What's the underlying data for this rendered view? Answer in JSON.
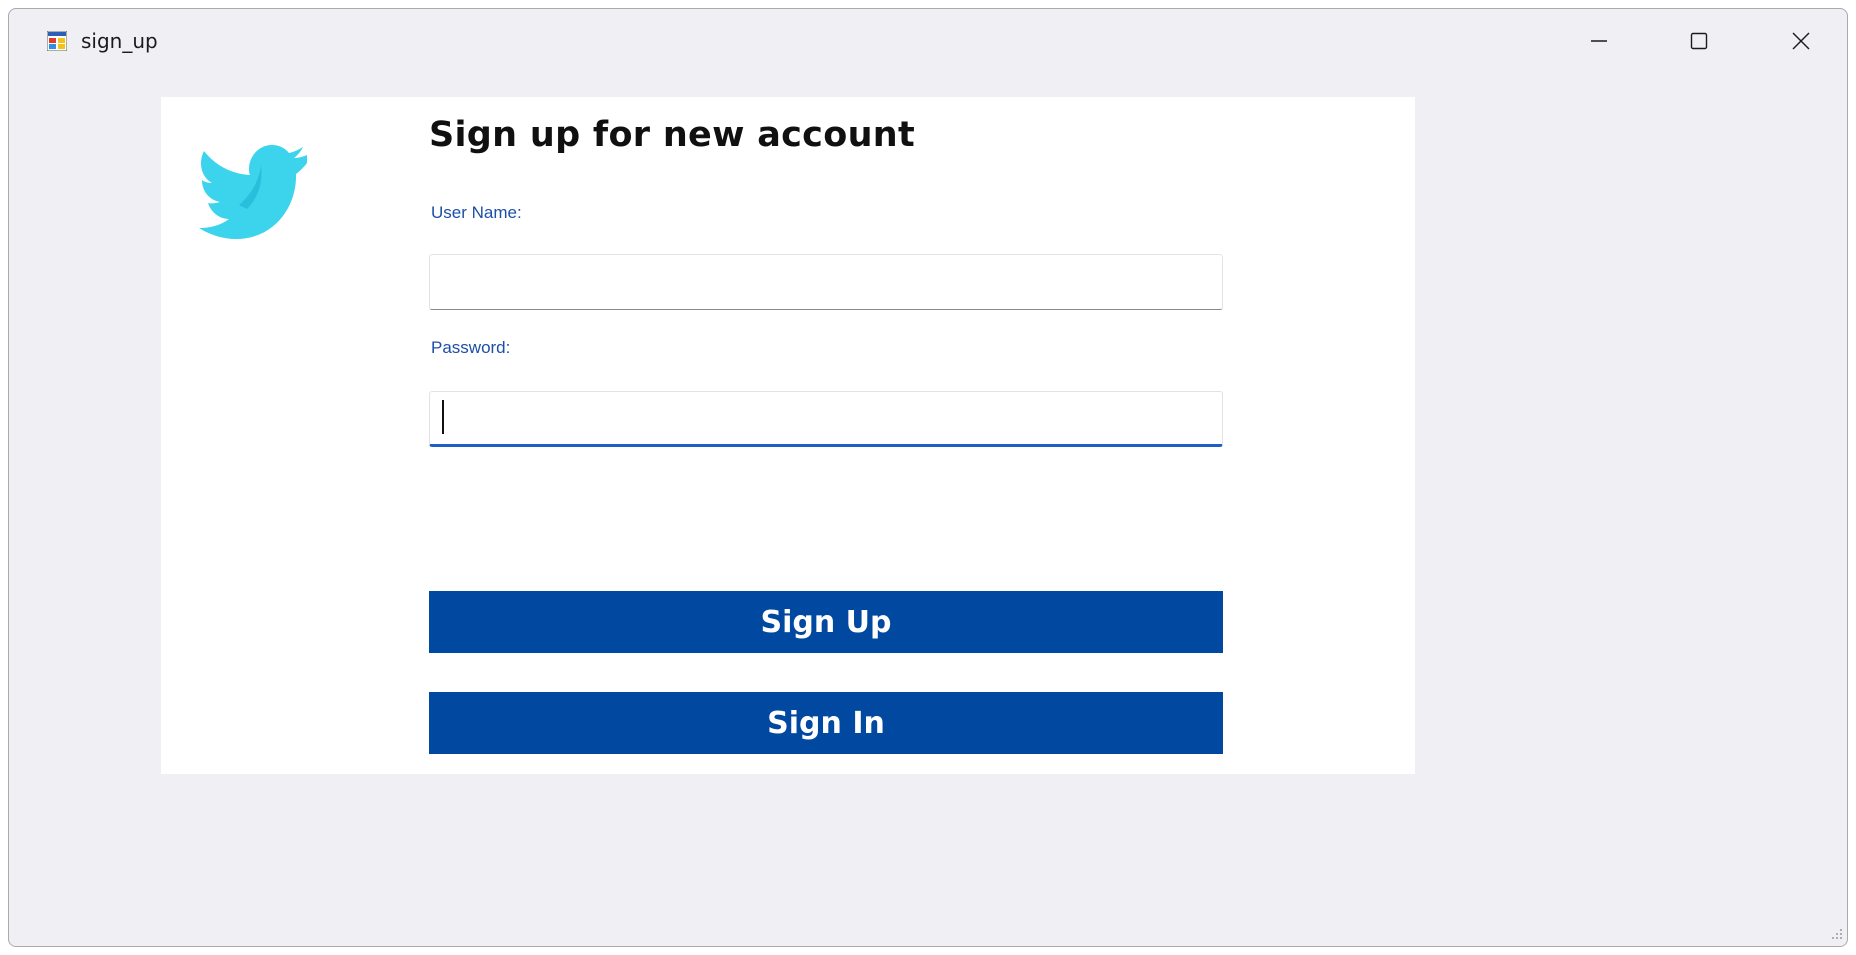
{
  "window": {
    "title": "sign_up",
    "app_icon": "winforms-app-icon",
    "controls": {
      "minimize_icon": "minimize-icon",
      "maximize_icon": "maximize-icon",
      "close_icon": "close-icon"
    }
  },
  "form": {
    "logo_icon": "twitter-bird-icon",
    "heading": "Sign up for new account",
    "username": {
      "label": "User Name:",
      "value": "",
      "placeholder": ""
    },
    "password": {
      "label": "Password:",
      "value": "",
      "placeholder": ""
    },
    "signup_button": "Sign Up",
    "signin_button": "Sign In"
  },
  "colors": {
    "window_bg": "#f0eff3",
    "panel_bg": "#ffffff",
    "label_color": "#1c4fa8",
    "button_bg": "#0048a0",
    "button_text": "#ffffff",
    "focus_underline": "#1d5fc4",
    "bird_color": "#3cd3ec"
  }
}
